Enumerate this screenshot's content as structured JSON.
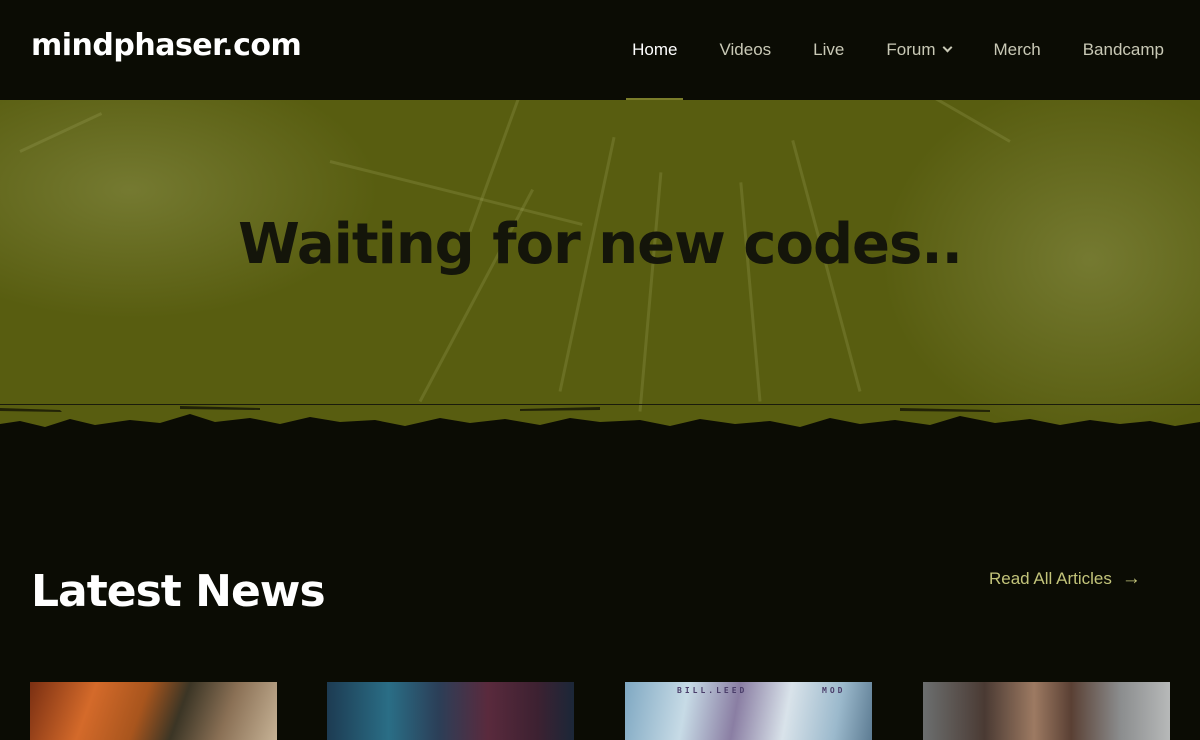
{
  "site": {
    "logo": "mindphaser.com"
  },
  "nav": {
    "items": [
      {
        "label": "Home",
        "active": true
      },
      {
        "label": "Videos",
        "active": false
      },
      {
        "label": "Live",
        "active": false
      },
      {
        "label": "Forum",
        "active": false,
        "has_dropdown": true
      },
      {
        "label": "Merch",
        "active": false
      },
      {
        "label": "Bandcamp",
        "active": false
      }
    ]
  },
  "hero": {
    "title": "Waiting for new codes.."
  },
  "news": {
    "title": "Latest News",
    "read_all_label": "Read All Articles",
    "read_all_icon": "arrow-right-icon",
    "articles": [
      {
        "image": "article-thumbnail-1"
      },
      {
        "image": "article-thumbnail-2"
      },
      {
        "image": "article-thumbnail-3",
        "image_text_left": "BILL.LEED",
        "image_text_right": "MOD"
      },
      {
        "image": "article-thumbnail-4"
      }
    ]
  },
  "colors": {
    "background": "#0b0c04",
    "hero": "#585d10",
    "accent": "#c3c47a",
    "hero_text": "#14150a"
  }
}
